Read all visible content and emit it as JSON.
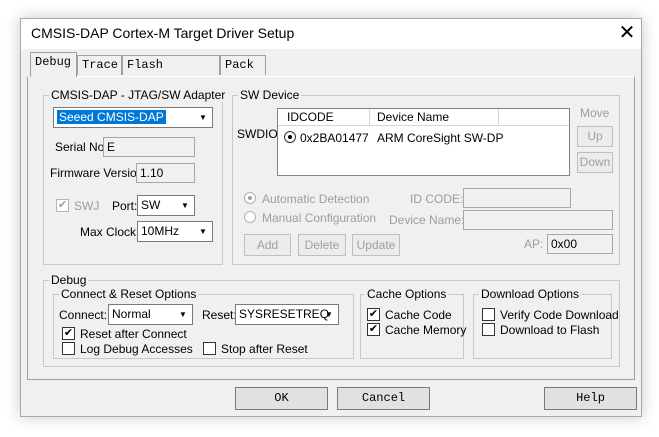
{
  "window": {
    "title": "CMSIS-DAP Cortex-M Target Driver Setup",
    "close_glyph": "✕"
  },
  "tabs": [
    {
      "label": "Debug"
    },
    {
      "label": "Trace"
    },
    {
      "label": "Flash Download"
    },
    {
      "label": "Pack"
    }
  ],
  "adapter": {
    "group_label": "CMSIS-DAP - JTAG/SW Adapter",
    "device": "Seeed CMSIS-DAP",
    "serial_label": "Serial No:",
    "serial": "E",
    "firmware_label": "Firmware Version:",
    "firmware": "1.10",
    "swj_label": "SWJ",
    "port_label": "Port:",
    "port": "SW",
    "maxclock_label": "Max Clock:",
    "maxclock": "10MHz"
  },
  "sw_device": {
    "group_label": "SW Device",
    "swdio_label": "SWDIO",
    "col_idcode": "IDCODE",
    "col_name": "Device Name",
    "row": {
      "idcode": "0x2BA01477",
      "name": "ARM CoreSight SW-DP"
    },
    "move_label": "Move",
    "up_label": "Up",
    "down_label": "Down",
    "auto_label": "Automatic Detection",
    "manual_label": "Manual Configuration",
    "idcode_label": "ID CODE:",
    "devname_label": "Device Name:",
    "add_label": "Add",
    "delete_label": "Delete",
    "update_label": "Update",
    "ap_label": "AP:",
    "ap_value": "0x00"
  },
  "debug": {
    "group_label": "Debug",
    "connect_group": "Connect & Reset Options",
    "connect_label": "Connect:",
    "connect_value": "Normal",
    "reset_label": "Reset:",
    "reset_value": "SYSRESETREQ",
    "reset_after_connect": "Reset after Connect",
    "log_debug": "Log Debug Accesses",
    "stop_after_reset": "Stop after Reset",
    "cache_group": "Cache Options",
    "cache_code": "Cache Code",
    "cache_memory": "Cache Memory",
    "download_group": "Download Options",
    "verify_code": "Verify Code Download",
    "download_flash": "Download to Flash"
  },
  "footer": {
    "ok": "OK",
    "cancel": "Cancel",
    "help": "Help"
  },
  "colors": {
    "selection": "#0078d7",
    "window_bg": "#f0f0f0"
  }
}
